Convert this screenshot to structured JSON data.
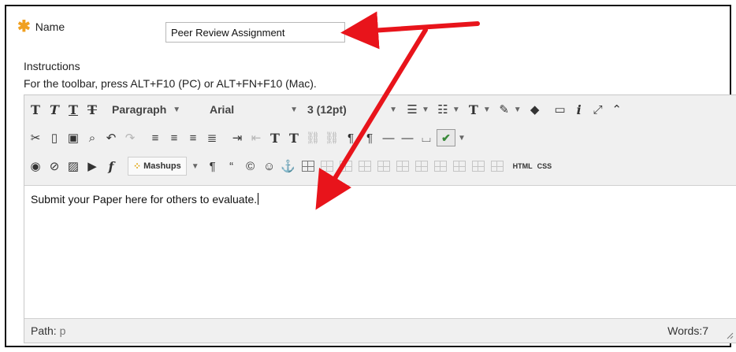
{
  "form": {
    "name_label": "Name",
    "name_value": "Peer Review Assignment",
    "instructions_label": "Instructions",
    "toolbar_hint": "For the toolbar, press ALT+F10 (PC) or ALT+FN+F10 (Mac)."
  },
  "toolbar": {
    "paragraph": "Paragraph",
    "font": "Arial",
    "size": "3 (12pt)",
    "mashups": "Mashups",
    "html_label": "HTML",
    "css_label": "CSS"
  },
  "editor": {
    "content": "Submit your Paper here for others to evaluate."
  },
  "status": {
    "path_label": "Path:",
    "path_value": "p",
    "words": "Words:7"
  },
  "annotation": {
    "arrow_color": "#e8141b"
  }
}
